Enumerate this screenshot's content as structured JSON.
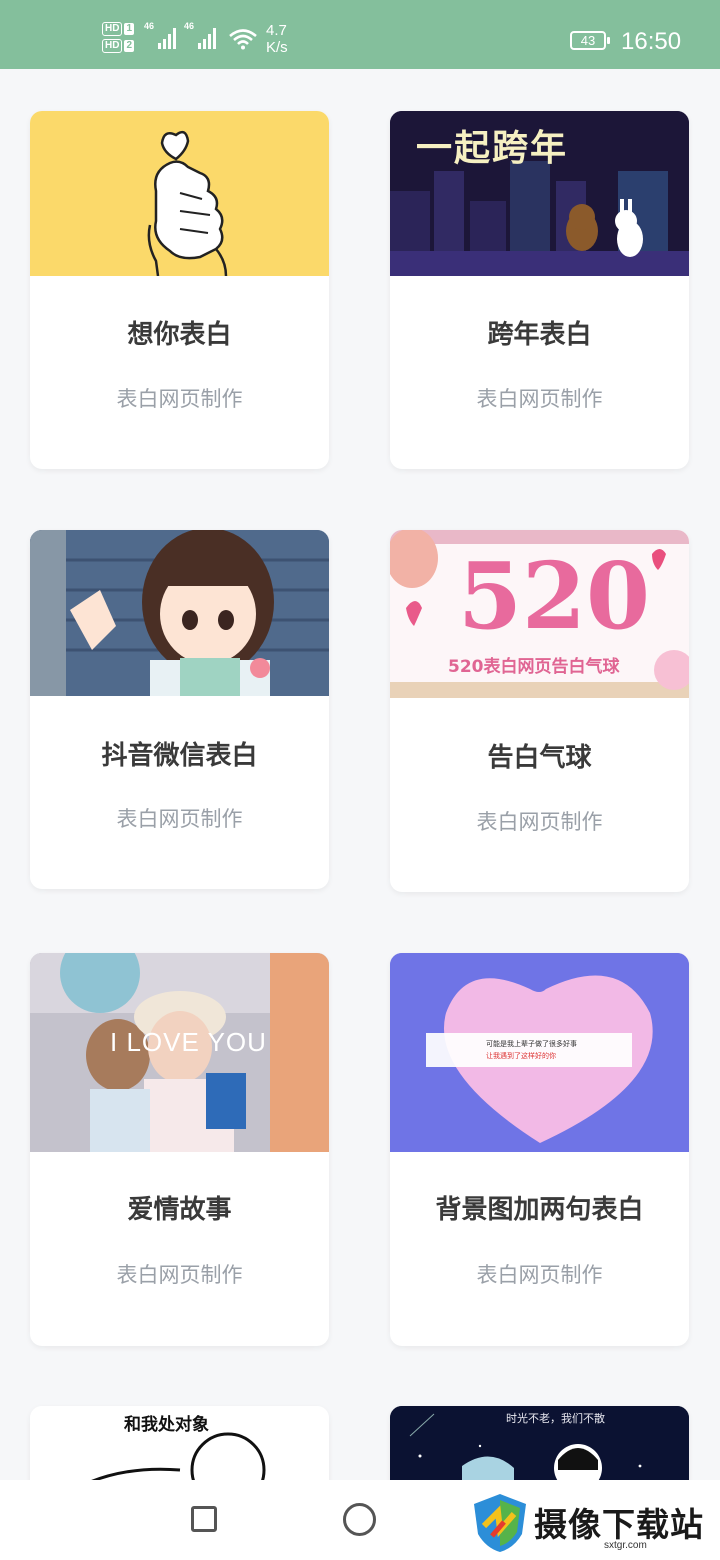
{
  "status_bar": {
    "sim1_hd": "HD",
    "sim1_num": "1",
    "sim2_hd": "HD",
    "sim2_num": "2",
    "net1": "46",
    "net2": "46",
    "speed_value": "4.7",
    "speed_unit": "K/s",
    "battery": "43",
    "time": "16:50",
    "bg_color": "#84bf9c"
  },
  "cards": [
    {
      "title": "想你表白",
      "subtitle": "表白网页制作",
      "thumb_icon": "finger-heart-icon"
    },
    {
      "title": "跨年表白",
      "subtitle": "表白网页制作",
      "thumb_text": "一起跨年"
    },
    {
      "title": "抖音微信表白",
      "subtitle": "表白网页制作",
      "thumb_icon": "anime-girl-image"
    },
    {
      "title": "告白气球",
      "subtitle": "表白网页制作",
      "thumb_big": "520",
      "thumb_small": "520表白网页告白气球"
    },
    {
      "title": "爱情故事",
      "subtitle": "表白网页制作",
      "thumb_text": "I LOVE YOU"
    },
    {
      "title": "背景图加两句表白",
      "subtitle": "表白网页制作",
      "thumb_line1": "可能是我上辈子做了很多好事",
      "thumb_line2": "让我遇到了这样好的你"
    },
    {
      "thumb_text": "和我处对象"
    },
    {
      "thumb_text": "时光不老，我们不散"
    }
  ],
  "nav": {
    "back": "square-nav-icon",
    "home": "circle-nav-icon"
  },
  "watermark": {
    "text": "摄像下载站",
    "url": "sxtgr.com"
  }
}
